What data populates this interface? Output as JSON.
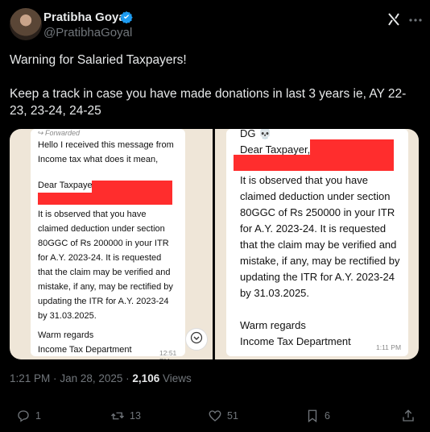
{
  "author": {
    "name": "Pratibha Goyal",
    "handle": "@PratibhaGoyal",
    "verified": true,
    "verified_color": "#1d9bf0"
  },
  "tweet": {
    "text": "Warning for Salaried Taxpayers!\n\nKeep a track in case you have made donations in last 3 years ie, AY 22-23, 23-24, 24-25"
  },
  "media": {
    "left": {
      "forwarded": "Forwarded",
      "intro": "Hello I received this message from\nIncome tax what does it mean,",
      "salutation": "Dear Taxpayer",
      "body": "It is observed that you have\nclaimed deduction under section\n80GGC of Rs  200000 in your ITR\nfor A.Y. 2023-24. It is requested\nthat the claim may be verified and\nmistake, if any, may be rectified by\nupdating the ITR for A.Y. 2023-24\nby 31.03.2025.",
      "signoff": "Warm regards\nIncome Tax Department",
      "time": "12:51 PM"
    },
    "right": {
      "top": "DG 💀",
      "salutation": "Dear Taxpayer,",
      "body": "It is observed that you have\nclaimed deduction under section\n80GGC of Rs  250000 in your ITR\nfor A.Y. 2023-24. It is requested\nthat the claim may be verified and\nmistake, if any, may be rectified by\nupdating the ITR for A.Y. 2023-24\nby 31.03.2025.",
      "signoff": "Warm regards\nIncome Tax Department",
      "time": "1:11 PM"
    },
    "redaction_color": "#ff2d2d"
  },
  "meta": {
    "time": "1:21 PM",
    "separator": "·",
    "date": "Jan 28, 2025",
    "views_count": "2,106",
    "views_label": "Views"
  },
  "actions": {
    "replies": "1",
    "reposts": "13",
    "likes": "51",
    "bookmarks": "6"
  },
  "icons": [
    "verified-icon",
    "grok-icon",
    "more-icon",
    "chevron-down-icon",
    "reply-icon",
    "repost-icon",
    "like-icon",
    "bookmark-icon",
    "share-icon"
  ]
}
